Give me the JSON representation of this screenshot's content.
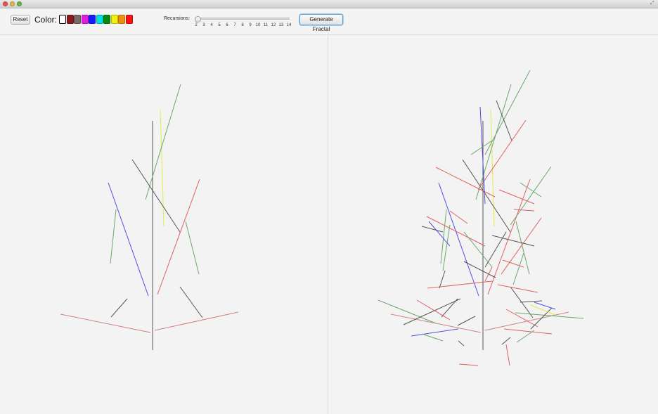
{
  "window": {
    "controls": [
      "close",
      "minimize",
      "zoom"
    ]
  },
  "toolbar": {
    "reset_label": "Reset",
    "color_label": "Color:",
    "colors": [
      "#ffffff",
      "#8b1a1a",
      "#7a6a6a",
      "#e01ee0",
      "#1a1aff",
      "#00e0e0",
      "#0a8a0a",
      "#f0f010",
      "#f09010",
      "#ff1010"
    ],
    "selected_color_index": 0,
    "recursions_label": "Recursions:",
    "recursion_ticks": [
      "2",
      "3",
      "4",
      "5",
      "6",
      "7",
      "8",
      "9",
      "10",
      "11",
      "12",
      "13",
      "14"
    ],
    "recursion_value": 1,
    "generate_label": "Generate Fractal"
  }
}
